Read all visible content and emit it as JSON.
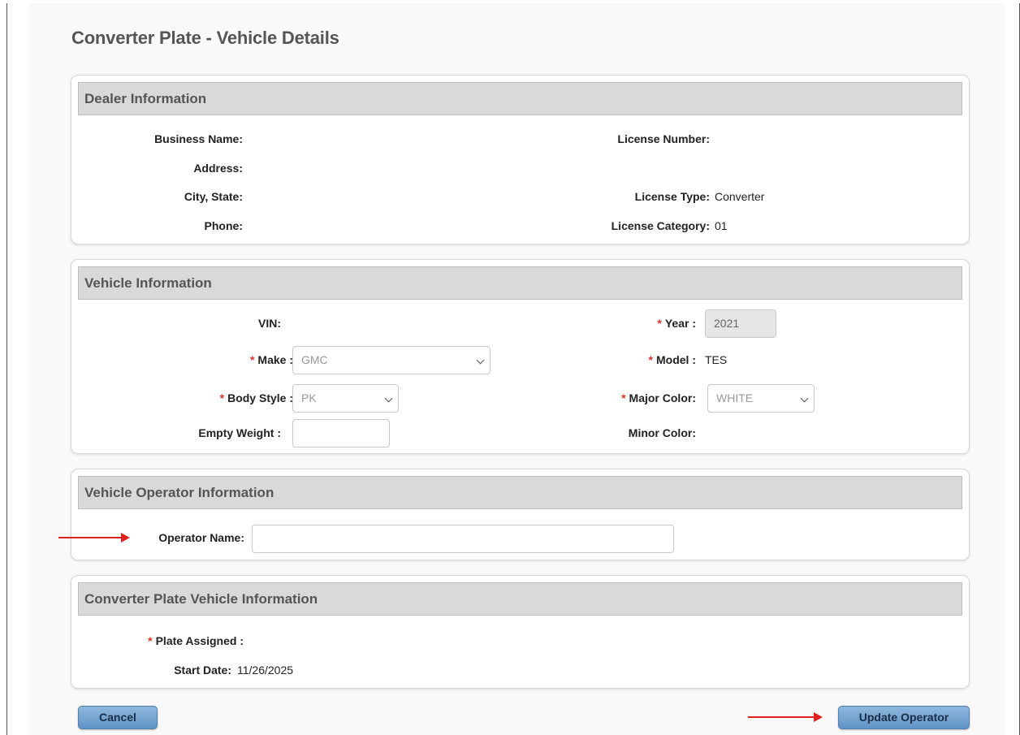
{
  "page": {
    "title": "Converter Plate - Vehicle Details"
  },
  "dealer": {
    "header": "Dealer Information",
    "business_name_label": "Business Name:",
    "address_label": "Address:",
    "city_state_label": "City, State:",
    "phone_label": "Phone:",
    "license_number_label": "License Number:",
    "license_type_label": "License Type:",
    "license_type_value": "Converter",
    "license_category_label": "License Category:",
    "license_category_value": "01"
  },
  "vehicle": {
    "header": "Vehicle Information",
    "vin_label": "VIN:",
    "make_label": "Make :",
    "make_value": "GMC",
    "body_style_label": "Body Style :",
    "body_style_value": "PK",
    "empty_weight_label": "Empty Weight :",
    "empty_weight_value": "",
    "year_label": "Year :",
    "year_value": "2021",
    "model_label": "Model :",
    "model_value": "TES",
    "major_color_label": "Major Color:",
    "major_color_value": "WHITE",
    "minor_color_label": "Minor Color:",
    "required_marker": "*"
  },
  "operator": {
    "header": "Vehicle Operator Information",
    "operator_name_label": "Operator Name:",
    "operator_name_value": ""
  },
  "converter_plate": {
    "header": "Converter Plate Vehicle Information",
    "plate_assigned_label": "Plate Assigned :",
    "start_date_label": "Start Date:",
    "start_date_value": "11/26/2025"
  },
  "actions": {
    "cancel_label": "Cancel",
    "update_operator_label": "Update Operator"
  },
  "colors": {
    "required": "#e0302a",
    "annotation_arrow": "#e02020",
    "button": "#6f9fcf",
    "panel_header": "#d9d9d9"
  }
}
